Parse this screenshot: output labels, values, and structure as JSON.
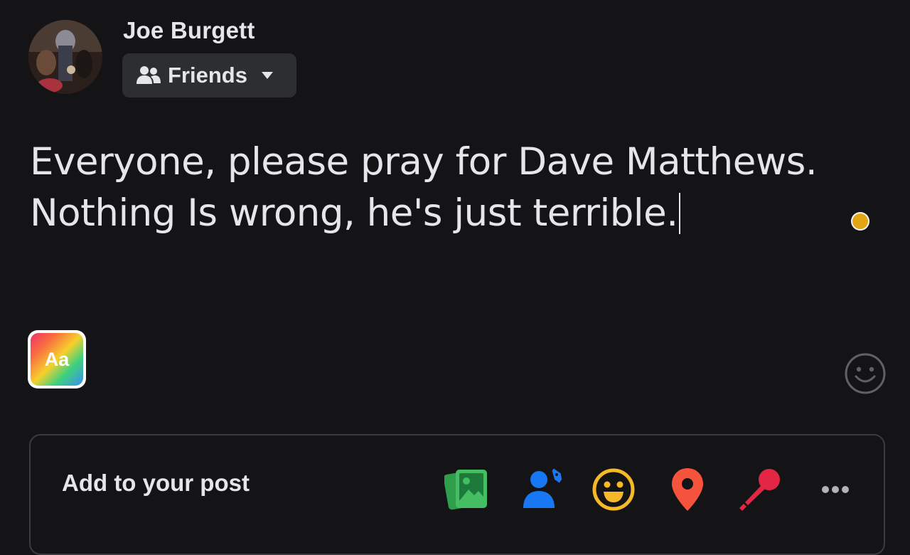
{
  "author": {
    "name": "Joe Burgett",
    "avatar_icon": "profile-photo"
  },
  "audience": {
    "label": "Friends",
    "icon": "friends-icon"
  },
  "post": {
    "lines": [
      "Everyone, please pray for Dave Matthews.",
      "Nothing Is wrong, he's just terrible."
    ]
  },
  "text_style_button": {
    "label": "Aa"
  },
  "add_to_post": {
    "label": "Add to your post",
    "tools": [
      {
        "name": "photo-video",
        "color": "#45bd62"
      },
      {
        "name": "tag-people",
        "color": "#1877f2"
      },
      {
        "name": "feeling-activity",
        "color": "#f7b928"
      },
      {
        "name": "check-in",
        "color": "#f5533d"
      },
      {
        "name": "live-audio",
        "color": "#e42645"
      },
      {
        "name": "more",
        "color": "#b0b3b8"
      }
    ]
  },
  "colors": {
    "background": "#141416",
    "text": "#e4e6eb",
    "status_dot": "#e2a513"
  }
}
